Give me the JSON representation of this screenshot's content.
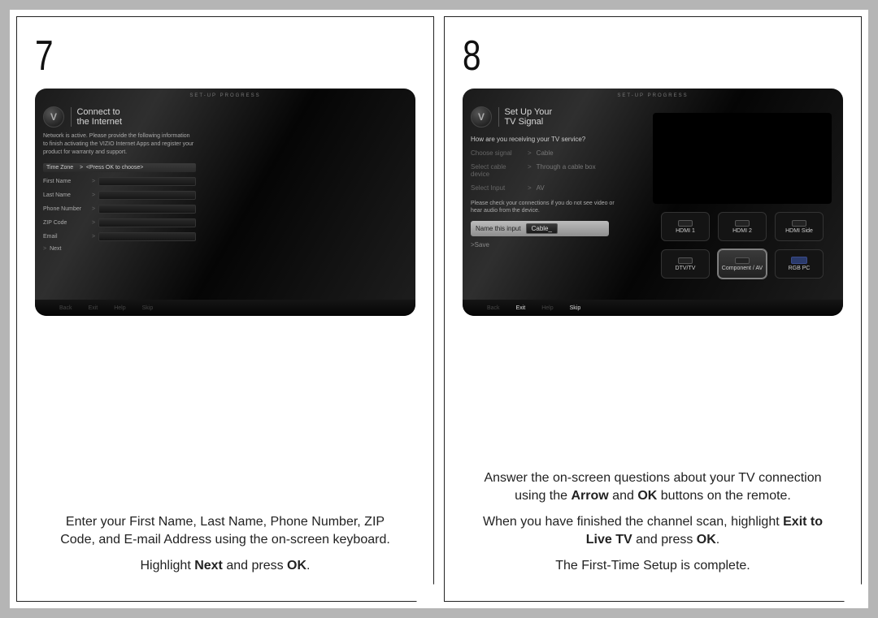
{
  "left": {
    "step": "7",
    "screen": {
      "header": "SET-UP PROGRESS",
      "title_line1": "Connect to",
      "title_line2": "the Internet",
      "desc": "Network is active. Please provide the following information to finish activating the VIZIO Internet Apps and register your product for warranty and support.",
      "hl_label": "Time Zone",
      "hl_value": "<Press OK to choose>",
      "rows": [
        "First Name",
        "Last Name",
        "Phone Number",
        "ZIP Code",
        "Email"
      ],
      "next": "Next",
      "bottom": [
        "Back",
        "Exit",
        "Help",
        "Skip"
      ]
    },
    "instr": {
      "p1": "Enter your First Name, Last Name, Phone Number, ZIP Code, and E-mail Address using the on-screen keyboard.",
      "p2_pre": "Highlight ",
      "p2_bold": "Next",
      "p2_post": " and press ",
      "p2_bold2": "OK",
      "p2_end": "."
    }
  },
  "right": {
    "step": "8",
    "screen": {
      "header": "SET-UP PROGRESS",
      "title_line1": "Set Up Your",
      "title_line2": "TV Signal",
      "question": "How are you receiving your TV service?",
      "opts": [
        {
          "label": "Choose signal",
          "value": "Cable"
        },
        {
          "label": "Select cable device",
          "value": "Through a cable box"
        },
        {
          "label": "Select Input",
          "value": "AV"
        }
      ],
      "note": "Please check your connections if you do not see video or hear audio from the device.",
      "name_label": "Name this input",
      "name_value": "Cable_",
      "save": ">Save",
      "bottom": [
        "Back",
        "Exit",
        "Help",
        "Skip"
      ],
      "tiles": [
        "HDMI 1",
        "HDMI 2",
        "HDMI Side",
        "DTV/TV",
        "Component / AV",
        "RGB PC"
      ]
    },
    "instr": {
      "p1_pre": "Answer the on-screen questions about your TV connection using the ",
      "p1_b1": "Arrow",
      "p1_mid": " and ",
      "p1_b2": "OK",
      "p1_post": " buttons on the remote.",
      "p2_pre": "When you have finished the channel scan, highlight ",
      "p2_b": "Exit to Live TV",
      "p2_mid": " and press ",
      "p2_b2": "OK",
      "p2_end": ".",
      "p3": "The First-Time Setup is complete."
    }
  }
}
